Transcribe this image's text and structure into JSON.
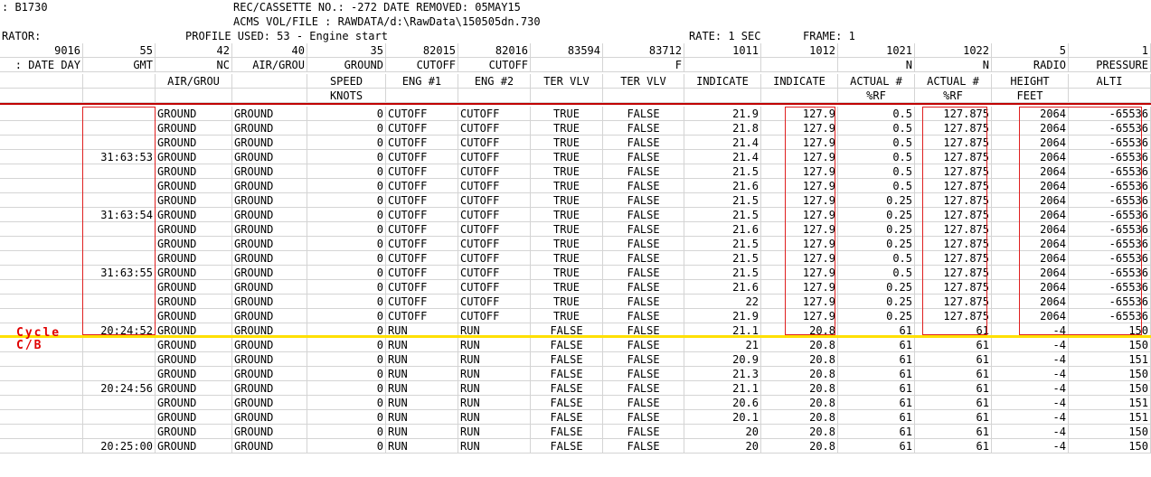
{
  "header": {
    "line1_left": ": B1730",
    "line1_mid": "REC/CASSETTE NO.: -272   DATE REMOVED: 05MAY15",
    "line2_mid": "ACMS VOL/FILE   : RAWDATA/d:\\RawData\\150505dn.730",
    "line3_left": "RATOR:",
    "line3_mid": "PROFILE USED: 53 - Engine start",
    "line3_rate": "RATE: 1 SEC",
    "line3_frame": "FRAME: 1"
  },
  "columns": {
    "ids": [
      "9016",
      "55",
      "42",
      "40",
      "35",
      "82015",
      "82016",
      "83594",
      "83712",
      "1011",
      "1012",
      "1021",
      "1022",
      "5",
      "1"
    ],
    "label1": [
      ": DATE DAY",
      "GMT",
      "NC",
      "AIR/GROU",
      "GROUND",
      "CUTOFF",
      "CUTOFF",
      "",
      "F",
      "",
      "",
      "N",
      "N",
      "RADIO",
      "PRESSURE"
    ],
    "label2": [
      "",
      "",
      "AIR/GROU",
      "",
      "SPEED",
      "ENG #1",
      "ENG #2",
      "TER VLV",
      "TER VLV",
      "INDICATE",
      "INDICATE",
      "ACTUAL #",
      "ACTUAL #",
      "HEIGHT",
      "ALTI"
    ],
    "label3": [
      "",
      "",
      "",
      "",
      "KNOTS",
      "",
      "",
      "",
      "",
      "",
      "",
      "%RF",
      "%RF",
      "FEET",
      ""
    ]
  },
  "rows": [
    [
      "",
      "",
      "GROUND",
      "GROUND",
      "0",
      "CUTOFF",
      "CUTOFF",
      "TRUE",
      "FALSE",
      "21.9",
      "127.9",
      "0.5",
      "127.875",
      "2064",
      "-65536"
    ],
    [
      "",
      "",
      "GROUND",
      "GROUND",
      "0",
      "CUTOFF",
      "CUTOFF",
      "TRUE",
      "FALSE",
      "21.8",
      "127.9",
      "0.5",
      "127.875",
      "2064",
      "-65536"
    ],
    [
      "",
      "",
      "GROUND",
      "GROUND",
      "0",
      "CUTOFF",
      "CUTOFF",
      "TRUE",
      "FALSE",
      "21.4",
      "127.9",
      "0.5",
      "127.875",
      "2064",
      "-65536"
    ],
    [
      "",
      "31:63:53",
      "GROUND",
      "GROUND",
      "0",
      "CUTOFF",
      "CUTOFF",
      "TRUE",
      "FALSE",
      "21.4",
      "127.9",
      "0.5",
      "127.875",
      "2064",
      "-65536"
    ],
    [
      "",
      "",
      "GROUND",
      "GROUND",
      "0",
      "CUTOFF",
      "CUTOFF",
      "TRUE",
      "FALSE",
      "21.5",
      "127.9",
      "0.5",
      "127.875",
      "2064",
      "-65536"
    ],
    [
      "",
      "",
      "GROUND",
      "GROUND",
      "0",
      "CUTOFF",
      "CUTOFF",
      "TRUE",
      "FALSE",
      "21.6",
      "127.9",
      "0.5",
      "127.875",
      "2064",
      "-65536"
    ],
    [
      "",
      "",
      "GROUND",
      "GROUND",
      "0",
      "CUTOFF",
      "CUTOFF",
      "TRUE",
      "FALSE",
      "21.5",
      "127.9",
      "0.25",
      "127.875",
      "2064",
      "-65536"
    ],
    [
      "",
      "31:63:54",
      "GROUND",
      "GROUND",
      "0",
      "CUTOFF",
      "CUTOFF",
      "TRUE",
      "FALSE",
      "21.5",
      "127.9",
      "0.25",
      "127.875",
      "2064",
      "-65536"
    ],
    [
      "",
      "",
      "GROUND",
      "GROUND",
      "0",
      "CUTOFF",
      "CUTOFF",
      "TRUE",
      "FALSE",
      "21.6",
      "127.9",
      "0.25",
      "127.875",
      "2064",
      "-65536"
    ],
    [
      "",
      "",
      "GROUND",
      "GROUND",
      "0",
      "CUTOFF",
      "CUTOFF",
      "TRUE",
      "FALSE",
      "21.5",
      "127.9",
      "0.25",
      "127.875",
      "2064",
      "-65536"
    ],
    [
      "",
      "",
      "GROUND",
      "GROUND",
      "0",
      "CUTOFF",
      "CUTOFF",
      "TRUE",
      "FALSE",
      "21.5",
      "127.9",
      "0.5",
      "127.875",
      "2064",
      "-65536"
    ],
    [
      "",
      "31:63:55",
      "GROUND",
      "GROUND",
      "0",
      "CUTOFF",
      "CUTOFF",
      "TRUE",
      "FALSE",
      "21.5",
      "127.9",
      "0.5",
      "127.875",
      "2064",
      "-65536"
    ],
    [
      "",
      "",
      "GROUND",
      "GROUND",
      "0",
      "CUTOFF",
      "CUTOFF",
      "TRUE",
      "FALSE",
      "21.6",
      "127.9",
      "0.25",
      "127.875",
      "2064",
      "-65536"
    ],
    [
      "",
      "",
      "GROUND",
      "GROUND",
      "0",
      "CUTOFF",
      "CUTOFF",
      "TRUE",
      "FALSE",
      "22",
      "127.9",
      "0.25",
      "127.875",
      "2064",
      "-65536"
    ],
    [
      "",
      "",
      "GROUND",
      "GROUND",
      "0",
      "CUTOFF",
      "CUTOFF",
      "TRUE",
      "FALSE",
      "21.9",
      "127.9",
      "0.25",
      "127.875",
      "2064",
      "-65536"
    ],
    [
      "",
      "20:24:52",
      "GROUND",
      "GROUND",
      "0",
      "RUN",
      "RUN",
      "FALSE",
      "FALSE",
      "21.1",
      "20.8",
      "61",
      "61",
      "-4",
      "150"
    ],
    [
      "",
      "",
      "GROUND",
      "GROUND",
      "0",
      "RUN",
      "RUN",
      "FALSE",
      "FALSE",
      "21",
      "20.8",
      "61",
      "61",
      "-4",
      "150"
    ],
    [
      "",
      "",
      "GROUND",
      "GROUND",
      "0",
      "RUN",
      "RUN",
      "FALSE",
      "FALSE",
      "20.9",
      "20.8",
      "61",
      "61",
      "-4",
      "151"
    ],
    [
      "",
      "",
      "GROUND",
      "GROUND",
      "0",
      "RUN",
      "RUN",
      "FALSE",
      "FALSE",
      "21.3",
      "20.8",
      "61",
      "61",
      "-4",
      "150"
    ],
    [
      "",
      "20:24:56",
      "GROUND",
      "GROUND",
      "0",
      "RUN",
      "RUN",
      "FALSE",
      "FALSE",
      "21.1",
      "20.8",
      "61",
      "61",
      "-4",
      "150"
    ],
    [
      "",
      "",
      "GROUND",
      "GROUND",
      "0",
      "RUN",
      "RUN",
      "FALSE",
      "FALSE",
      "20.6",
      "20.8",
      "61",
      "61",
      "-4",
      "151"
    ],
    [
      "",
      "",
      "GROUND",
      "GROUND",
      "0",
      "RUN",
      "RUN",
      "FALSE",
      "FALSE",
      "20.1",
      "20.8",
      "61",
      "61",
      "-4",
      "151"
    ],
    [
      "",
      "",
      "GROUND",
      "GROUND",
      "0",
      "RUN",
      "RUN",
      "FALSE",
      "FALSE",
      "20",
      "20.8",
      "61",
      "61",
      "-4",
      "150"
    ],
    [
      "",
      "20:25:00",
      "GROUND",
      "GROUND",
      "0",
      "RUN",
      "RUN",
      "FALSE",
      "FALSE",
      "20",
      "20.8",
      "61",
      "61",
      "-4",
      "150"
    ]
  ],
  "annotation": {
    "text_line1": "Cycle",
    "text_line2": "C/B",
    "color": "#e00000",
    "separator_color": "#ffe000"
  }
}
